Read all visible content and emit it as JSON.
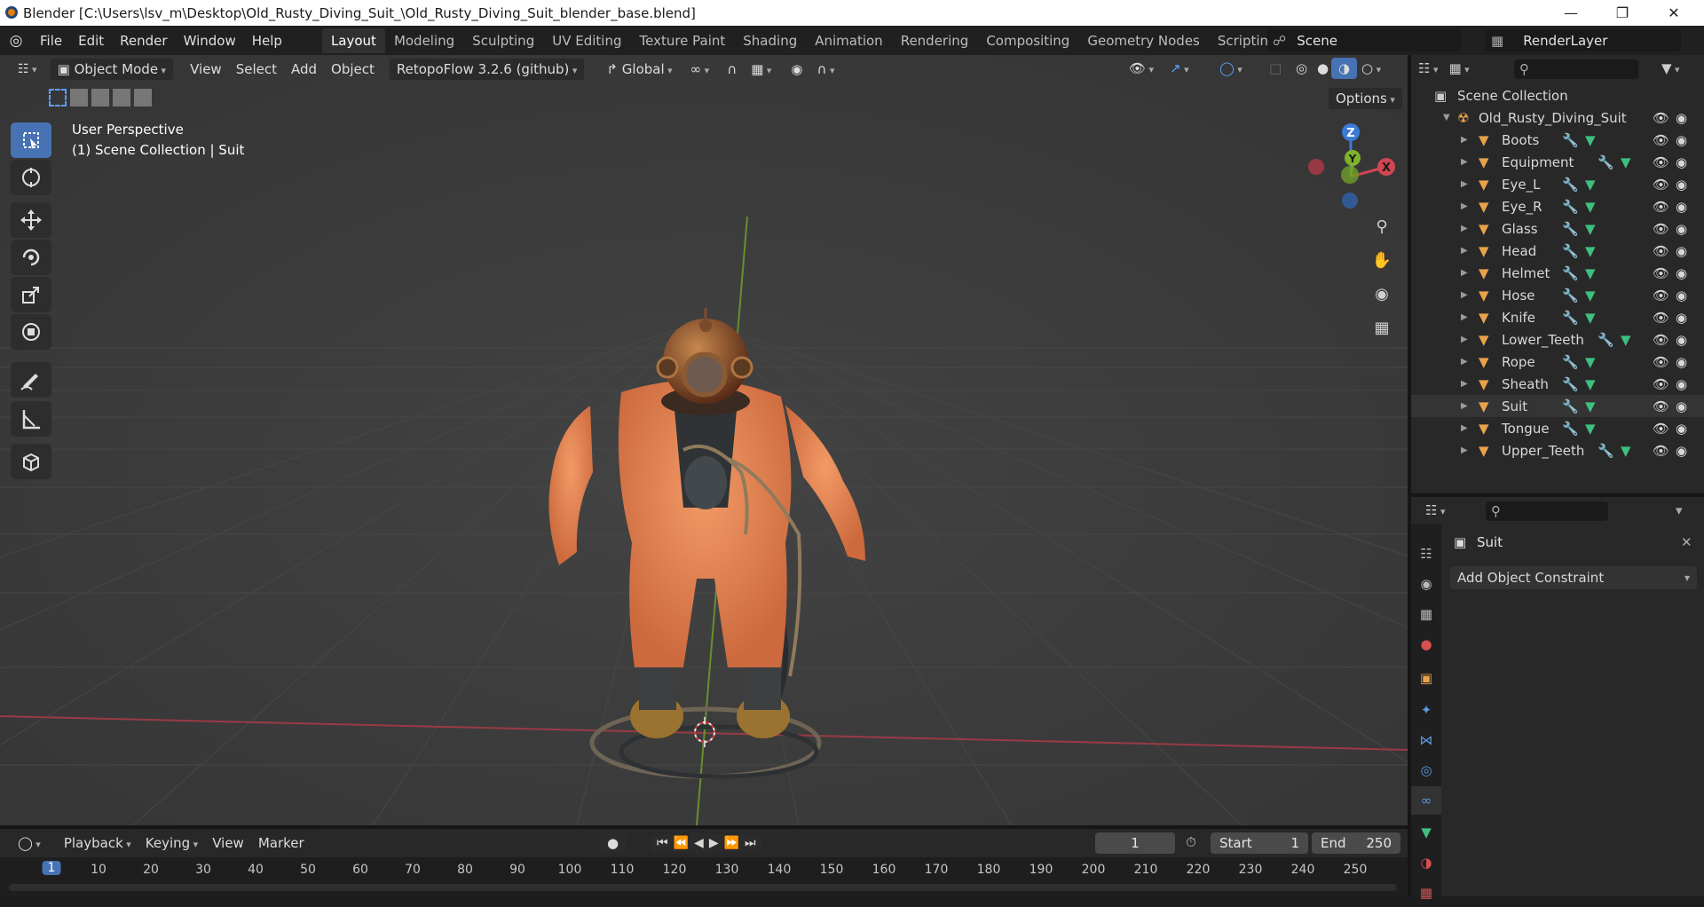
{
  "window": {
    "title": "Blender [C:\\Users\\lsv_m\\Desktop\\Old_Rusty_Diving_Suit_\\Old_Rusty_Diving_Suit_blender_base.blend]",
    "minimize": "—",
    "restore": "❐",
    "close": "✕"
  },
  "menubar": {
    "items": [
      "File",
      "Edit",
      "Render",
      "Window",
      "Help"
    ],
    "workspaces": [
      "Layout",
      "Modeling",
      "Sculpting",
      "UV Editing",
      "Texture Paint",
      "Shading",
      "Animation",
      "Rendering",
      "Compositing",
      "Geometry Nodes",
      "Scripting"
    ],
    "active_workspace": "Layout",
    "add_tab": "+",
    "scene": "Scene",
    "view_layer": "RenderLayer"
  },
  "viewport_header": {
    "mode": "Object Mode",
    "menus": [
      "View",
      "Select",
      "Add",
      "Object"
    ],
    "addon": "RetopoFlow 3.2.6 (github)",
    "transform_orientation": "Global",
    "options": "Options"
  },
  "viewport": {
    "perspective": "User Perspective",
    "collection_info": "(1) Scene Collection | Suit",
    "gizmo": {
      "z": "Z",
      "y": "Y",
      "x": "X"
    },
    "colors": {
      "bg": "#3c3c3c",
      "grid": "#474747",
      "x_axis": "#9a3a45",
      "y_axis": "#6a8e2d",
      "suit": "#e8804e"
    }
  },
  "outliner": {
    "root": "Scene Collection",
    "collection": "Old_Rusty_Diving_Suit",
    "objects": [
      "Boots",
      "Equipment",
      "Eye_L",
      "Eye_R",
      "Glass",
      "Head",
      "Helmet",
      "Hose",
      "Knife",
      "Lower_Teeth",
      "Rope",
      "Sheath",
      "Suit",
      "Tongue",
      "Upper_Teeth"
    ],
    "selected": "Suit"
  },
  "properties": {
    "object_name": "Suit",
    "add_constraint": "Add Object Constraint"
  },
  "timeline": {
    "menus": [
      "Playback",
      "Keying",
      "View",
      "Marker"
    ],
    "current_frame": "1",
    "start_label": "Start",
    "start": "1",
    "end_label": "End",
    "end": "250",
    "ticks": [
      "1",
      "10",
      "20",
      "30",
      "40",
      "50",
      "60",
      "70",
      "80",
      "90",
      "100",
      "110",
      "120",
      "130",
      "140",
      "150",
      "160",
      "170",
      "180",
      "190",
      "200",
      "210",
      "220",
      "230",
      "240",
      "250"
    ]
  }
}
